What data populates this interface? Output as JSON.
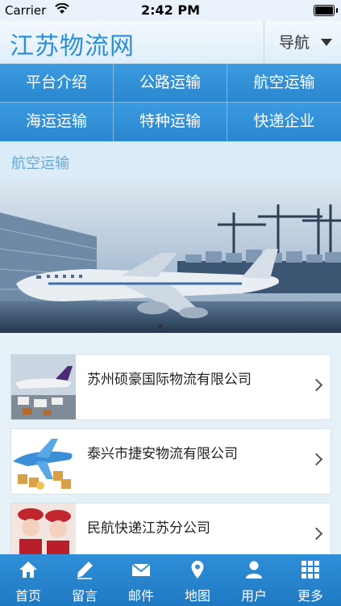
{
  "status_bar": {
    "carrier": "Carrier",
    "time": "2:42 PM"
  },
  "header": {
    "title": "江苏物流网",
    "nav_label": "导航"
  },
  "categories": [
    {
      "label": "平台介绍"
    },
    {
      "label": "公路运输"
    },
    {
      "label": "航空运输"
    },
    {
      "label": "海运运输"
    },
    {
      "label": "特种运输"
    },
    {
      "label": "快递企业"
    }
  ],
  "section": {
    "title": "航空运输"
  },
  "companies": [
    {
      "name": "苏州硕豪国际物流有限公司"
    },
    {
      "name": "泰兴市捷安物流有限公司"
    },
    {
      "name": "民航快递江苏分公司"
    }
  ],
  "tabbar": [
    {
      "label": "首页",
      "icon": "home-icon"
    },
    {
      "label": "留言",
      "icon": "pencil-icon"
    },
    {
      "label": "邮件",
      "icon": "mail-icon"
    },
    {
      "label": "地图",
      "icon": "map-pin-icon"
    },
    {
      "label": "用户",
      "icon": "user-icon"
    },
    {
      "label": "更多",
      "icon": "grid-icon"
    }
  ],
  "colors": {
    "accent": "#2f8fd8",
    "title": "#2b8fd8",
    "section_text": "#6aa9d8"
  }
}
